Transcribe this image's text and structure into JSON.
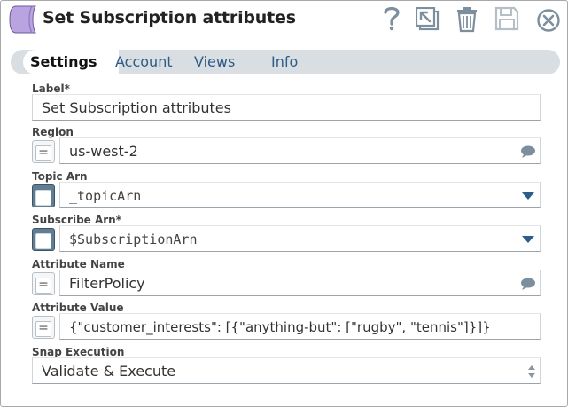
{
  "header": {
    "title": "Set Subscription attributes",
    "icons": [
      "help-icon",
      "export-icon",
      "trash-icon",
      "save-icon",
      "close-icon"
    ]
  },
  "tabs": [
    {
      "label": "Settings",
      "active": true
    },
    {
      "label": "Account"
    },
    {
      "label": "Views"
    },
    {
      "label": "Info"
    }
  ],
  "fields": {
    "label": {
      "label": "Label*",
      "value": "Set Subscription attributes"
    },
    "region": {
      "label": "Region",
      "value": "us-west-2"
    },
    "topic_arn": {
      "label": "Topic Arn",
      "value": "_topicArn"
    },
    "subscribe_arn": {
      "label": "Subscribe Arn*",
      "value": "$SubscriptionArn"
    },
    "attribute_name": {
      "label": "Attribute Name",
      "value": "FilterPolicy"
    },
    "attribute_value": {
      "label": "Attribute Value",
      "value": "{\"customer_interests\": [{\"anything-but\": [\"rugby\", \"tennis\"]}]}"
    },
    "snap_execution": {
      "label": "Snap Execution",
      "value": "Validate & Execute"
    }
  },
  "expression_symbol": "=",
  "colors": {
    "accent_purple": "#b9a3e0",
    "tab_bar": "#d9dee2",
    "tab_link": "#2b5b86",
    "expr_on": "#607d92",
    "caret": "#2e5d8a"
  }
}
